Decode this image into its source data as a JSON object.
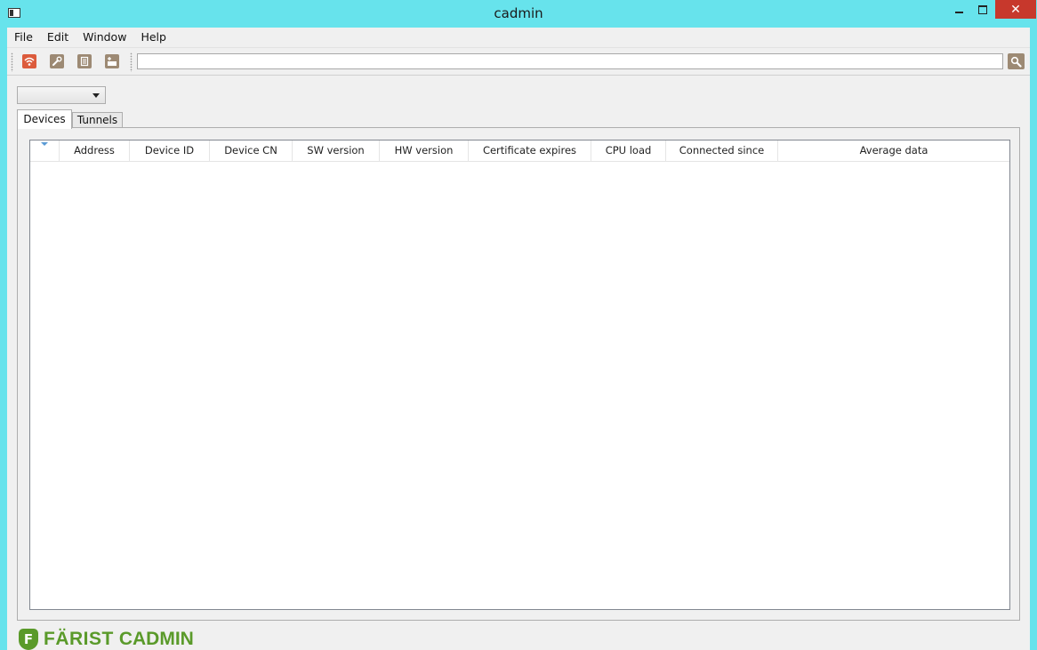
{
  "window": {
    "title": "cadmin",
    "close_glyph": "✕"
  },
  "menu": [
    "File",
    "Edit",
    "Window",
    "Help"
  ],
  "toolbar": {
    "icons": [
      "wifi-icon",
      "wrench-icon",
      "document-icon",
      "terminal-add-icon"
    ],
    "search_value": "",
    "search_icon": "search-icon"
  },
  "selector": {
    "value": ""
  },
  "tabs": [
    "Devices",
    "Tunnels"
  ],
  "active_tab": "Devices",
  "table": {
    "columns": [
      "",
      "Address",
      "Device ID",
      "Device CN",
      "SW version",
      "HW version",
      "Certificate expires",
      "CPU load",
      "Connected since",
      "Average data"
    ],
    "rows": []
  },
  "brand": {
    "badge": "F",
    "name": "FÄRIST",
    "product": "CADMIN",
    "color": "#5a9a2a"
  },
  "colors": {
    "titlebar": "#67e3ec",
    "close": "#c7382c",
    "accent": "#dc5b3c",
    "tool": "#9d8a74"
  }
}
